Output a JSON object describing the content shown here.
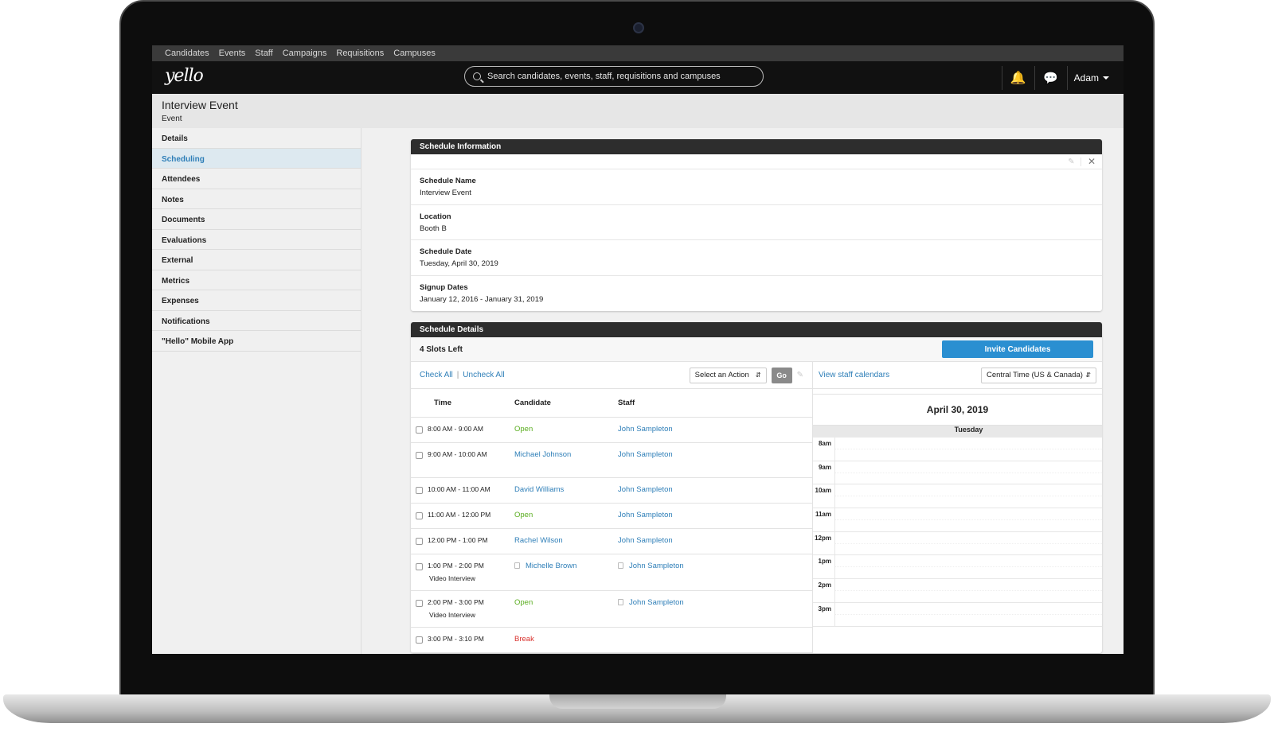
{
  "topnav": [
    "Candidates",
    "Events",
    "Staff",
    "Campaigns",
    "Requisitions",
    "Campuses"
  ],
  "header": {
    "logo": "yello",
    "search_placeholder": "Search candidates, events, staff, requisitions and campuses",
    "user": "Adam"
  },
  "page": {
    "title": "Interview Event",
    "subtitle": "Event"
  },
  "sidebar": {
    "items": [
      "Details",
      "Scheduling",
      "Attendees",
      "Notes",
      "Documents",
      "Evaluations",
      "External",
      "Metrics",
      "Expenses",
      "Notifications",
      "\"Hello\" Mobile App"
    ],
    "active": "Scheduling"
  },
  "schedule_info": {
    "heading": "Schedule Information",
    "fields": [
      {
        "label": "Schedule Name",
        "value": "Interview Event"
      },
      {
        "label": "Location",
        "value": "Booth B"
      },
      {
        "label": "Schedule Date",
        "value": "Tuesday, April 30, 2019"
      },
      {
        "label": "Signup Dates",
        "value": "January 12, 2016 - January 31, 2019"
      }
    ]
  },
  "schedule_details": {
    "heading": "Schedule Details",
    "slots_left": "4 Slots Left",
    "invite_button": "Invite Candidates",
    "check_all": "Check All",
    "uncheck_all": "Uncheck All",
    "action_select": "Select an Action",
    "go_button": "Go",
    "columns": {
      "time": "Time",
      "candidate": "Candidate",
      "staff": "Staff"
    },
    "rows": [
      {
        "time": "8:00 AM - 9:00 AM",
        "note": "",
        "candidate": "Open",
        "staff": "John Sampleton"
      },
      {
        "time": "9:00 AM - 10:00 AM",
        "note": "",
        "candidate": "Michael Johnson",
        "staff": "John Sampleton"
      },
      {
        "time": "10:00 AM - 11:00 AM",
        "note": "",
        "candidate": "David Williams",
        "staff": "John Sampleton"
      },
      {
        "time": "11:00 AM - 12:00 PM",
        "note": "",
        "candidate": "Open",
        "staff": "John Sampleton"
      },
      {
        "time": "12:00 PM - 1:00 PM",
        "note": "",
        "candidate": "Rachel Wilson",
        "staff": "John Sampleton"
      },
      {
        "time": "1:00 PM - 2:00 PM",
        "note": "Video Interview",
        "candidate": "Michelle Brown",
        "staff": "John Sampleton"
      },
      {
        "time": "2:00 PM - 3:00 PM",
        "note": "Video Interview",
        "candidate": "Open",
        "staff": "John Sampleton"
      },
      {
        "time": "3:00 PM - 3:10 PM",
        "note": "",
        "candidate": "Break",
        "staff": ""
      }
    ],
    "view_calendars": "View staff calendars",
    "timezone": "Central Time (US & Canada)",
    "calendar_date": "April 30, 2019",
    "calendar_day": "Tuesday",
    "hours": [
      "8am",
      "9am",
      "10am",
      "11am",
      "12pm",
      "1pm",
      "2pm",
      "3pm"
    ]
  }
}
